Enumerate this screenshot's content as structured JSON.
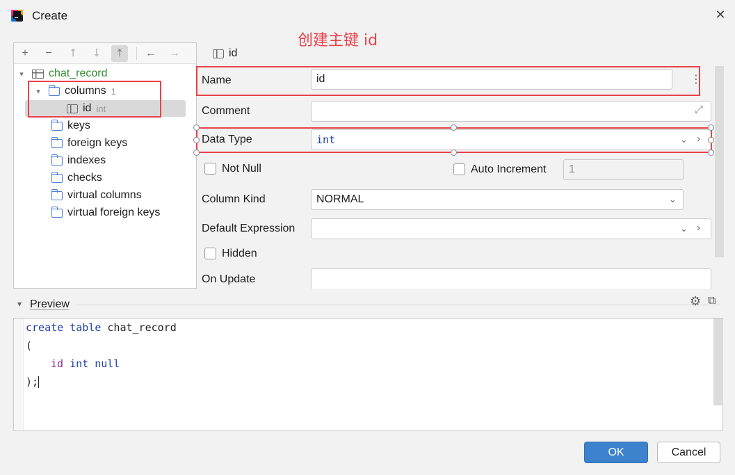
{
  "window": {
    "title": "Create",
    "close_icon": "close-icon"
  },
  "annotation": "创建主键 id",
  "toolbar": {
    "buttons": [
      {
        "name": "add-icon",
        "glyph": "+"
      },
      {
        "name": "remove-icon",
        "glyph": "−"
      },
      {
        "name": "move-up-icon",
        "glyph": "⭡"
      },
      {
        "name": "move-down-icon",
        "glyph": "⭣"
      },
      {
        "name": "move-top-icon",
        "glyph": "⤒"
      },
      {
        "name": "back-icon",
        "glyph": "←"
      },
      {
        "name": "forward-icon",
        "glyph": "→"
      }
    ]
  },
  "tree": {
    "table": "chat_record",
    "columns_label": "columns",
    "columns_count": "1",
    "column": {
      "name": "id",
      "type": "int"
    },
    "folders": [
      "keys",
      "foreign keys",
      "indexes",
      "checks",
      "virtual columns",
      "virtual foreign keys"
    ]
  },
  "editor": {
    "header": "id",
    "name_label": "Name",
    "name_value": "id",
    "comment_label": "Comment",
    "data_type_label": "Data Type",
    "data_type_value": "int",
    "not_null_label": "Not Null",
    "auto_increment_label": "Auto Increment",
    "auto_increment_value": "1",
    "column_kind_label": "Column Kind",
    "column_kind_value": "NORMAL",
    "default_expression_label": "Default Expression",
    "hidden_label": "Hidden",
    "on_update_label": "On Update"
  },
  "preview": {
    "label": "Preview",
    "code": {
      "l1_kw": "create table",
      "l1_name": " chat_record",
      "l2": "(",
      "l3_col": "id",
      "l3_rest": " int null",
      "l4": ");"
    }
  },
  "buttons": {
    "ok": "OK",
    "cancel": "Cancel"
  },
  "colors": {
    "accent": "#3d82cc",
    "annotation": "#e8424a",
    "table_name": "#2f8c2f"
  }
}
